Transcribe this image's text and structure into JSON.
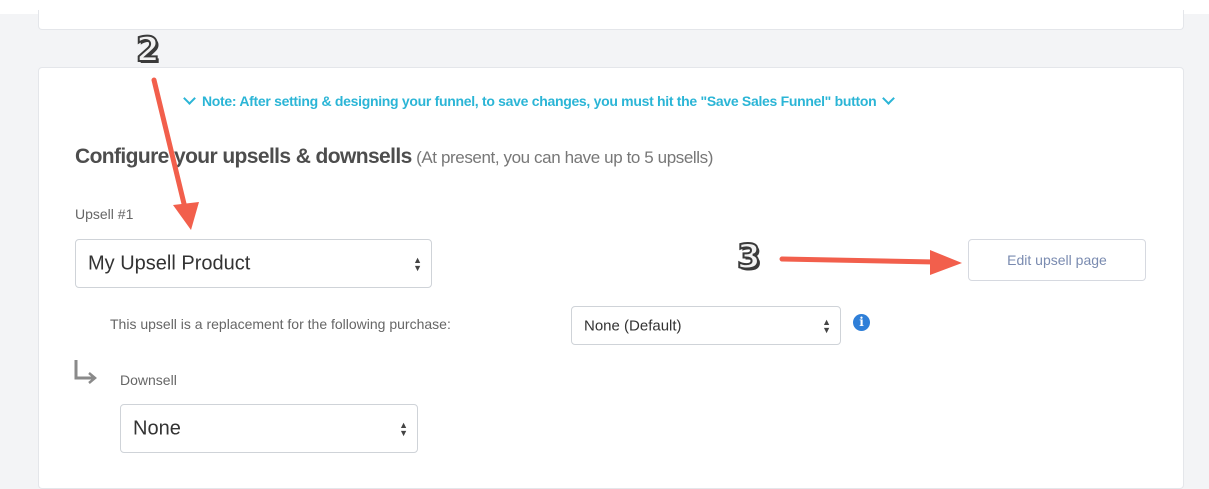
{
  "note": {
    "text": "Note: After setting & designing your funnel, to save changes, you must hit the \"Save Sales Funnel\" button"
  },
  "heading": {
    "title": "Configure your upsells & downsells",
    "subtitle": "(At present, you can have up to 5 upsells)"
  },
  "upsell": {
    "label": "Upsell #1",
    "selected": "My Upsell Product",
    "edit_button": "Edit upsell page"
  },
  "replacement": {
    "label": "This upsell is a replacement for the following purchase:",
    "selected": "None (Default)"
  },
  "downsell": {
    "label": "Downsell",
    "selected": "None"
  },
  "annotations": {
    "step2": "2",
    "step3": "3"
  },
  "colors": {
    "note": "#2bb5d6",
    "annotation_arrow": "#f25f4c",
    "info_icon": "#2f7fd8"
  },
  "icons": [
    "chevron-down-icon",
    "select-arrows-icon",
    "info-icon",
    "subitem-arrow-icon",
    "annotation-arrow"
  ]
}
